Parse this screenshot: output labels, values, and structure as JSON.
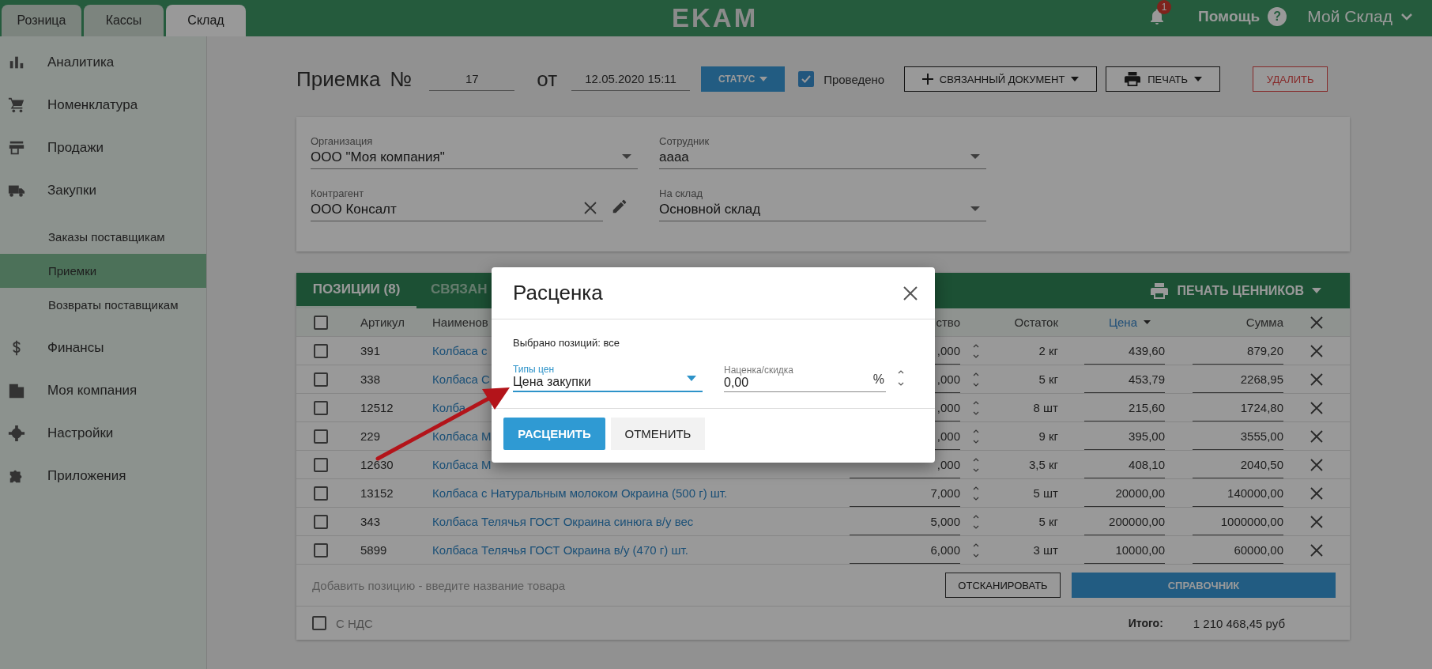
{
  "top_bar": {
    "tabs": [
      {
        "label": "Розница",
        "selected": false
      },
      {
        "label": "Кассы",
        "selected": false
      },
      {
        "label": "Склад",
        "selected": true
      }
    ],
    "logo": "EKAM",
    "notification_count": "1",
    "help": "Помощь",
    "help_icon": "?",
    "account": "Мой Склад"
  },
  "sidebar": {
    "items": [
      {
        "label": "Аналитика",
        "selected": false
      },
      {
        "label": "Номенклатура",
        "selected": false
      },
      {
        "label": "Продажи",
        "selected": false
      },
      {
        "label": "Закупки",
        "selected": false,
        "children": [
          {
            "label": "Заказы поставщикам",
            "selected": false
          },
          {
            "label": "Приемки",
            "selected": true
          },
          {
            "label": "Возвраты поставщикам",
            "selected": false
          }
        ]
      },
      {
        "label": "Финансы",
        "selected": false
      },
      {
        "label": "Моя компания",
        "selected": false
      },
      {
        "label": "Настройки",
        "selected": false
      },
      {
        "label": "Приложения",
        "selected": false
      }
    ]
  },
  "document": {
    "title": "Приемка",
    "number_label": "№",
    "number": "17",
    "date_label": "от",
    "date": "12.05.2020 15:11",
    "status_button": "СТАТУС",
    "posted": {
      "label": "Проведено",
      "checked": true
    },
    "linked_button": "СВЯЗАННЫЙ ДОКУМЕНТ",
    "print_button": "ПЕЧАТЬ",
    "delete_button": "УДАЛИТЬ"
  },
  "form": {
    "fields": [
      {
        "label": "Организация",
        "value": "ООО \"Моя компания\"",
        "kind": "select"
      },
      {
        "label": "Сотрудник",
        "value": "аааа",
        "kind": "select"
      },
      {
        "label": "Контрагент",
        "value": "ООО Консалт",
        "kind": "clearable"
      },
      {
        "label": "На склад",
        "value": "Основной склад",
        "kind": "select"
      }
    ]
  },
  "positions": {
    "tabs": [
      {
        "label": "ПОЗИЦИИ (8)",
        "selected": true
      },
      {
        "label": "СВЯЗАН",
        "selected": false
      }
    ],
    "print_labels_button": "ПЕЧАТЬ ЦЕННИКОВ",
    "select_all": {
      "checked": false
    },
    "columns": [
      {
        "label": "Артикул",
        "sorted": false
      },
      {
        "label": "Наименов",
        "sorted": false
      },
      {
        "label": "ство",
        "sorted": false
      },
      {
        "label": "Остаток",
        "sorted": false
      },
      {
        "label": "Цена",
        "sorted": true
      },
      {
        "label": "Сумма",
        "sorted": false
      }
    ],
    "rows": [
      {
        "checked": false,
        "sku": "391",
        "name": "Колбаса с",
        "qty": ",000",
        "stock": "2 кг",
        "price": "439,60",
        "sum": "879,20"
      },
      {
        "checked": false,
        "sku": "338",
        "name": "Колбаса С",
        "qty": ",000",
        "stock": "5 кг",
        "price": "453,79",
        "sum": "2268,95"
      },
      {
        "checked": false,
        "sku": "12512",
        "name": "Колба",
        "qty": ",000",
        "stock": "8 шт",
        "price": "215,60",
        "sum": "1724,80"
      },
      {
        "checked": false,
        "sku": "229",
        "name": "Колбаса М",
        "qty": ",000",
        "stock": "9 кг",
        "price": "395,00",
        "sum": "3555,00"
      },
      {
        "checked": false,
        "sku": "12630",
        "name": "Колбаса М",
        "qty": ",000",
        "stock": "3,5 кг",
        "price": "408,10",
        "sum": "2040,50"
      },
      {
        "checked": false,
        "sku": "13152",
        "name": "Колбаса с Натуральным молоком Окраина (500 г) шт.",
        "qty": "7,000",
        "stock": "5 шт",
        "price": "20000,00",
        "sum": "140000,00"
      },
      {
        "checked": false,
        "sku": "343",
        "name": "Колбаса Телячья ГОСТ Окраина синюга в/у вес",
        "qty": "5,000",
        "stock": "5 кг",
        "price": "200000,00",
        "sum": "1000000,00"
      },
      {
        "checked": false,
        "sku": "5899",
        "name": "Колбаса Телячья ГОСТ Окраина в/у (470 г) шт.",
        "qty": "6,000",
        "stock": "3 шт",
        "price": "10000,00",
        "sum": "60000,00"
      }
    ],
    "add_placeholder": "Добавить позицию - введите название товара",
    "scan_button": "ОТСКАНИРОВАТЬ",
    "catalog_button": "СПРАВОЧНИК",
    "vat": {
      "label": "С НДС",
      "checked": false
    },
    "total_label": "Итого:",
    "total": "1 210 468,45 руб"
  },
  "modal": {
    "title": "Расценка",
    "selected_info": "Выбрано позиций: все",
    "price_type": {
      "label": "Типы цен",
      "value": "Цена закупки",
      "focused": true
    },
    "markup": {
      "label": "Наценка/скидка",
      "value": "0,00",
      "unit": "%"
    },
    "apply_button": "РАСЦЕНИТЬ",
    "cancel_button": "ОТМЕНИТЬ"
  }
}
